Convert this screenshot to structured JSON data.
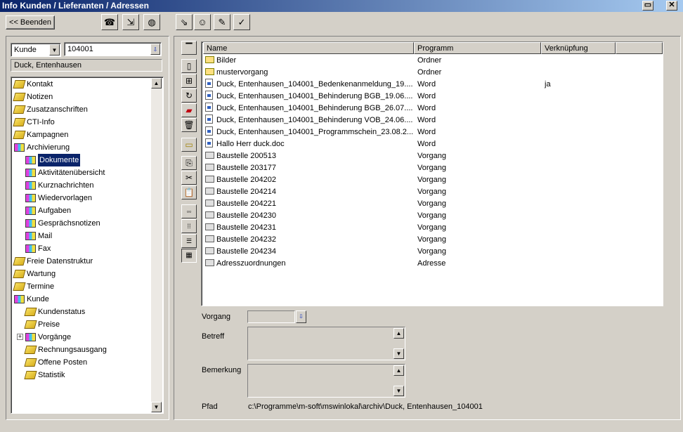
{
  "window": {
    "title": "Info Kunden / Lieferanten / Adressen"
  },
  "toolbar": {
    "back_label": "<< Beenden"
  },
  "customer": {
    "type_value": "Kunde",
    "number_value": "104001",
    "name": "Duck, Entenhausen"
  },
  "tree": {
    "items": [
      {
        "label": "Kontakt",
        "icon": "book-yellow",
        "level": 0
      },
      {
        "label": "Notizen",
        "icon": "book-yellow",
        "level": 0
      },
      {
        "label": "Zusatzanschriften",
        "icon": "book-yellow",
        "level": 0
      },
      {
        "label": "CTI-Info",
        "icon": "book-yellow",
        "level": 0
      },
      {
        "label": "Kampagnen",
        "icon": "book-yellow",
        "level": 0
      },
      {
        "label": "Archivierung",
        "icon": "books-multi",
        "level": 0
      },
      {
        "label": "Dokumente",
        "icon": "books-multi",
        "level": 1,
        "selected": true
      },
      {
        "label": "Aktivitätenübersicht",
        "icon": "books-multi",
        "level": 1
      },
      {
        "label": "Kurznachrichten",
        "icon": "books-multi",
        "level": 1
      },
      {
        "label": "Wiedervorlagen",
        "icon": "books-multi",
        "level": 1
      },
      {
        "label": "Aufgaben",
        "icon": "books-multi",
        "level": 1
      },
      {
        "label": "Gesprächsnotizen",
        "icon": "books-multi",
        "level": 1
      },
      {
        "label": "Mail",
        "icon": "books-multi",
        "level": 1
      },
      {
        "label": "Fax",
        "icon": "books-multi",
        "level": 1
      },
      {
        "label": "Freie Datenstruktur",
        "icon": "book-yellow",
        "level": 0
      },
      {
        "label": "Wartung",
        "icon": "book-yellow",
        "level": 0
      },
      {
        "label": "Termine",
        "icon": "book-yellow",
        "level": 0
      },
      {
        "label": "Kunde",
        "icon": "books-multi",
        "level": 0
      },
      {
        "label": "Kundenstatus",
        "icon": "book-yellow",
        "level": 1
      },
      {
        "label": "Preise",
        "icon": "book-yellow",
        "level": 1
      },
      {
        "label": "Vorgänge",
        "icon": "books-multi",
        "level": 1,
        "expander": "+"
      },
      {
        "label": "Rechnungsausgang",
        "icon": "book-yellow",
        "level": 1
      },
      {
        "label": "Offene Posten",
        "icon": "book-yellow",
        "level": 1
      },
      {
        "label": "Statistik",
        "icon": "book-yellow",
        "level": 1
      }
    ]
  },
  "list": {
    "columns": [
      "Name",
      "Programm",
      "Verknüpfung"
    ],
    "rows": [
      {
        "name": "Bilder",
        "program": "Ordner",
        "link": "",
        "icon": "folder-yellow"
      },
      {
        "name": "mustervorgang",
        "program": "Ordner",
        "link": "",
        "icon": "folder-yellow"
      },
      {
        "name": "Duck, Entenhausen_104001_Bedenkenanmeldung_19....",
        "program": "Word",
        "link": "ja",
        "icon": "word-doc"
      },
      {
        "name": "Duck, Entenhausen_104001_Behinderung BGB_19.06....",
        "program": "Word",
        "link": "",
        "icon": "word-doc"
      },
      {
        "name": "Duck, Entenhausen_104001_Behinderung BGB_26.07....",
        "program": "Word",
        "link": "",
        "icon": "word-doc"
      },
      {
        "name": "Duck, Entenhausen_104001_Behinderung VOB_24.06....",
        "program": "Word",
        "link": "",
        "icon": "word-doc"
      },
      {
        "name": "Duck, Entenhausen_104001_Programmschein_23.08.2...",
        "program": "Word",
        "link": "",
        "icon": "word-doc"
      },
      {
        "name": "Hallo Herr duck.doc",
        "program": "Word",
        "link": "",
        "icon": "word-doc"
      },
      {
        "name": "Baustelle 200513",
        "program": "Vorgang",
        "link": "",
        "icon": "folder-gray"
      },
      {
        "name": "Baustelle 203177",
        "program": "Vorgang",
        "link": "",
        "icon": "folder-gray"
      },
      {
        "name": "Baustelle 204202",
        "program": "Vorgang",
        "link": "",
        "icon": "folder-gray"
      },
      {
        "name": "Baustelle 204214",
        "program": "Vorgang",
        "link": "",
        "icon": "folder-gray"
      },
      {
        "name": "Baustelle 204221",
        "program": "Vorgang",
        "link": "",
        "icon": "folder-gray"
      },
      {
        "name": "Baustelle 204230",
        "program": "Vorgang",
        "link": "",
        "icon": "folder-gray"
      },
      {
        "name": "Baustelle 204231",
        "program": "Vorgang",
        "link": "",
        "icon": "folder-gray"
      },
      {
        "name": "Baustelle 204232",
        "program": "Vorgang",
        "link": "",
        "icon": "folder-gray"
      },
      {
        "name": "Baustelle 204234",
        "program": "Vorgang",
        "link": "",
        "icon": "folder-gray"
      },
      {
        "name": "Adresszuordnungen",
        "program": "Adresse",
        "link": "",
        "icon": "folder-gray"
      }
    ]
  },
  "details": {
    "vorgang_label": "Vorgang",
    "vorgang_value": "",
    "betreff_label": "Betreff",
    "betreff_value": "",
    "bemerkung_label": "Bemerkung",
    "bemerkung_value": "",
    "pfad_label": "Pfad",
    "pfad_value": "c:\\Programme\\m-soft\\mswinlokal\\archiv\\Duck, Entenhausen_104001"
  },
  "colors": {
    "title_start": "#0a246a",
    "title_end": "#a6caf0",
    "selection": "#0a246a",
    "face": "#d4d0c8"
  }
}
